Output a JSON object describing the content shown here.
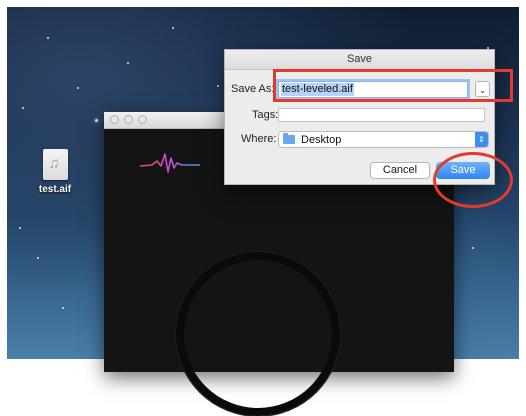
{
  "desktop": {
    "file_label": "test.aif",
    "file_icon": "music-file-icon"
  },
  "app_window": {
    "logo_icon": "waveform-logo-icon",
    "colors": {
      "background": "#141414"
    }
  },
  "save_dialog": {
    "title": "Save",
    "save_as_label": "Save As:",
    "filename_value": "test-leveled.aif",
    "tags_label": "Tags:",
    "tags_value": "",
    "where_label": "Where:",
    "where_value": "Desktop",
    "cancel_label": "Cancel",
    "save_label": "Save",
    "expand_icon": "chevron-down-icon",
    "folder_icon": "folder-icon"
  },
  "annotations": {
    "color": "#e23b2e"
  }
}
